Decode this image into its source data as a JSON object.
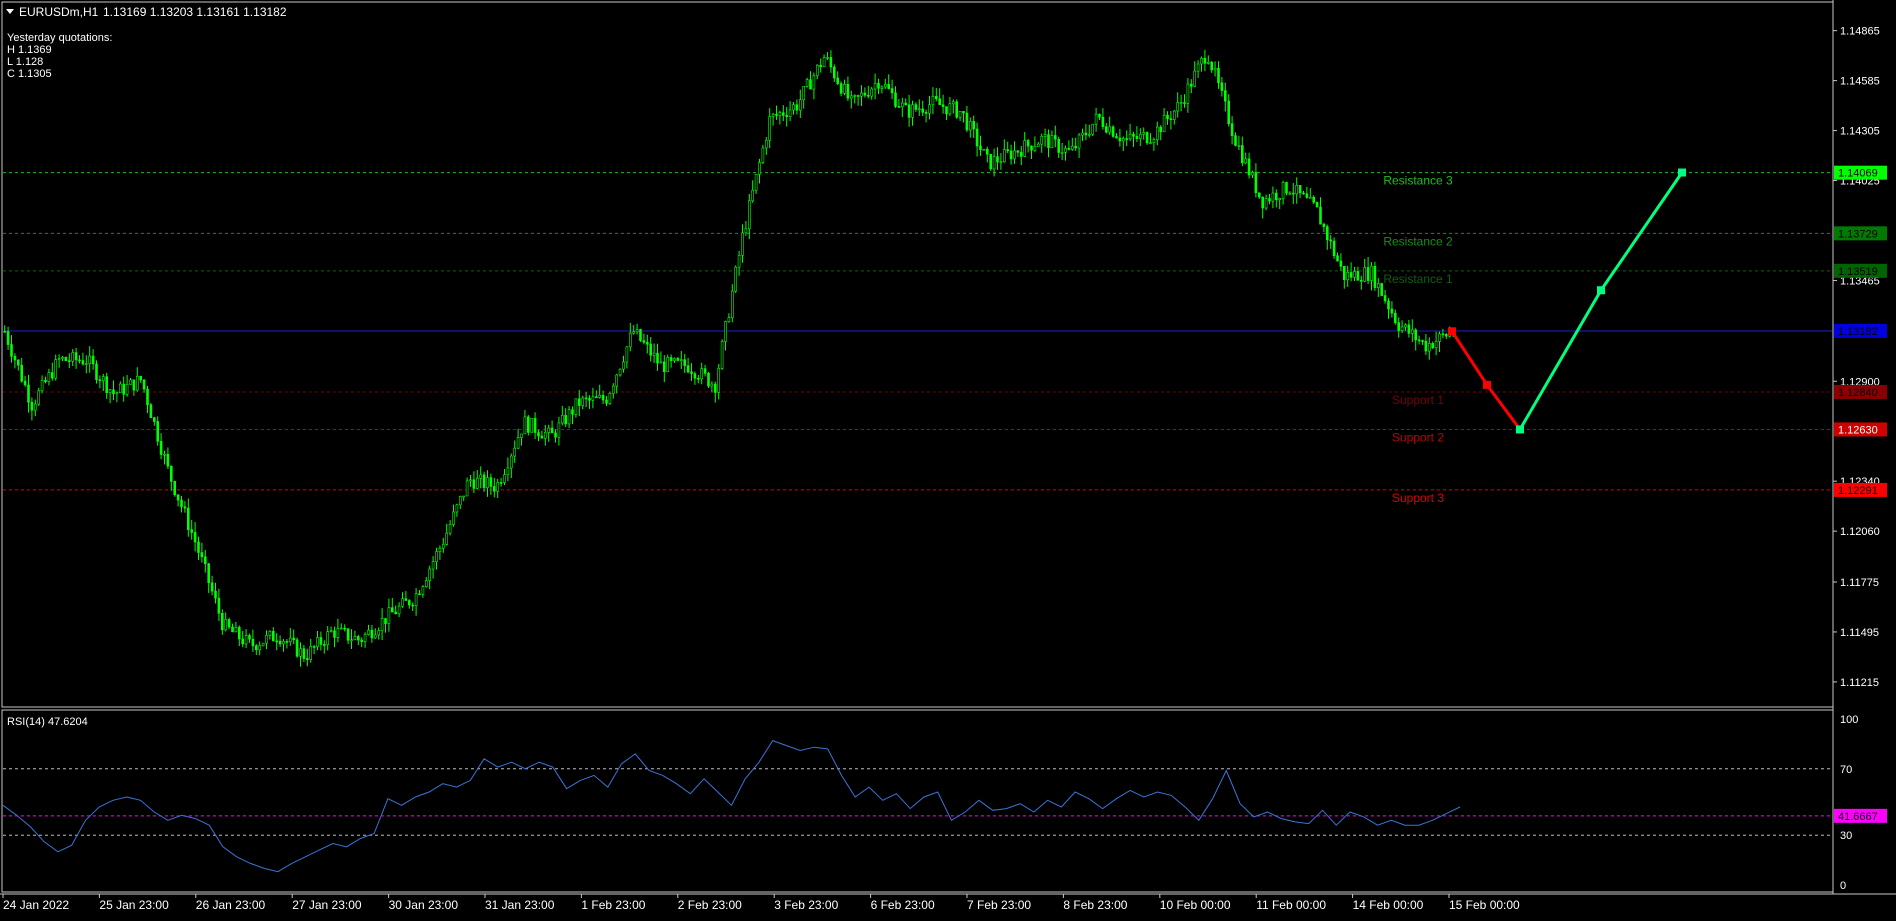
{
  "header": {
    "symbol": "EURUSDm,H1",
    "ohlc": "1.13169 1.13203 1.13161 1.13182",
    "yesterday_title": "Yesterday quotations:",
    "yesterday_high": "H 1.1369",
    "yesterday_low": "L 1.128",
    "yesterday_close": "C 1.1305"
  },
  "colors": {
    "background": "#000000",
    "bull_candle": "#00ff00",
    "bear_candle": "#00ff00",
    "pivot_line": "#0000ff",
    "resistance": "#00ff00",
    "support": "#ff0000",
    "rsi_line": "#3a75d8",
    "rsi_level_marker": "#ff00ff",
    "forecast_down": "#ff0000",
    "forecast_up": "#00ff7f",
    "axis_text": "#ffffff",
    "frame": "#c8c8c8"
  },
  "price_axis": {
    "ticks": [
      "1.14865",
      "1.14585",
      "1.14305",
      "1.14025",
      "1.13465",
      "1.12900",
      "1.12340",
      "1.12060",
      "1.11775",
      "1.11495",
      "1.11215"
    ],
    "tags": [
      {
        "label": "1.14069",
        "bg": "#00ff00",
        "fg": "#000000"
      },
      {
        "label": "1.13729",
        "bg": "#007a00",
        "fg": "#000000"
      },
      {
        "label": "1.13519",
        "bg": "#006400",
        "fg": "#000000"
      },
      {
        "label": "1.13182",
        "bg": "#0000e0",
        "fg": "#000000"
      },
      {
        "label": "1.12840",
        "bg": "#8a0000",
        "fg": "#000000"
      },
      {
        "label": "1.12630",
        "bg": "#d00000",
        "fg": "#ffffff"
      },
      {
        "label": "1.12291",
        "bg": "#ff0000",
        "fg": "#000000"
      }
    ]
  },
  "time_axis": {
    "labels": [
      "24 Jan 2022",
      "25 Jan 23:00",
      "26 Jan 23:00",
      "27 Jan 23:00",
      "30 Jan 23:00",
      "31 Jan 23:00",
      "1 Feb 23:00",
      "2 Feb 23:00",
      "3 Feb 23:00",
      "6 Feb 23:00",
      "7 Feb 23:00",
      "8 Feb 23:00",
      "10 Feb 00:00",
      "11 Feb 00:00",
      "14 Feb 00:00",
      "15 Feb 00:00"
    ]
  },
  "levels": [
    {
      "label": "Resistance 3",
      "value": 1.14069,
      "color": "#1fbf1f"
    },
    {
      "label": "Resistance 2",
      "value": 1.13729,
      "color": "#168f16"
    },
    {
      "label": "Resistance 1",
      "value": 1.13519,
      "color": "#0f5f0f"
    },
    {
      "label": "",
      "value": 1.13182,
      "color": "#1f1fd0"
    },
    {
      "label": "Support 1",
      "value": 1.1284,
      "color": "#7a0000"
    },
    {
      "label": "Support 2",
      "value": 1.1263,
      "color": "#c00000"
    },
    {
      "label": "Support 3",
      "value": 1.12291,
      "color": "#e00000"
    }
  ],
  "rsi": {
    "label": "RSI(14) 47.6204",
    "axis_ticks": [
      "100",
      "70",
      "30",
      "0"
    ],
    "level_marker": "41.6667"
  },
  "chart_data": [
    {
      "type": "candlestick",
      "title": "EURUSDm,H1",
      "ylim": [
        1.1108,
        1.1502
      ],
      "x_labels": [
        "24 Jan 2022",
        "25 Jan 23:00",
        "26 Jan 23:00",
        "27 Jan 23:00",
        "30 Jan 23:00",
        "31 Jan 23:00",
        "1 Feb 23:00",
        "2 Feb 23:00",
        "3 Feb 23:00",
        "6 Feb 23:00",
        "7 Feb 23:00",
        "8 Feb 23:00",
        "10 Feb 00:00",
        "11 Feb 00:00",
        "14 Feb 00:00",
        "15 Feb 00:00"
      ],
      "close_path": [
        {
          "t": "24 Jan 2022",
          "price": 1.1318
        },
        {
          "t": "25 Jan",
          "price": 1.1277
        },
        {
          "t": "25 Jan",
          "price": 1.1302
        },
        {
          "t": "25 Jan 23:00",
          "price": 1.1302
        },
        {
          "t": "26 Jan",
          "price": 1.1283
        },
        {
          "t": "26 Jan",
          "price": 1.1291
        },
        {
          "t": "26 Jan",
          "price": 1.1239
        },
        {
          "t": "26 Jan 23:00",
          "price": 1.1199
        },
        {
          "t": "27 Jan",
          "price": 1.1153
        },
        {
          "t": "27 Jan",
          "price": 1.1142
        },
        {
          "t": "27 Jan",
          "price": 1.1148
        },
        {
          "t": "27 Jan 23:00",
          "price": 1.1136
        },
        {
          "t": "28 Jan",
          "price": 1.115
        },
        {
          "t": "28 Jan",
          "price": 1.1145
        },
        {
          "t": "30 Jan 23:00",
          "price": 1.1158
        },
        {
          "t": "31 Jan",
          "price": 1.1169
        },
        {
          "t": "31 Jan",
          "price": 1.1199
        },
        {
          "t": "31 Jan",
          "price": 1.1235
        },
        {
          "t": "31 Jan 23:00",
          "price": 1.1231
        },
        {
          "t": "1 Feb",
          "price": 1.1267
        },
        {
          "t": "1 Feb",
          "price": 1.1259
        },
        {
          "t": "1 Feb",
          "price": 1.1278
        },
        {
          "t": "1 Feb 23:00",
          "price": 1.128
        },
        {
          "t": "2 Feb",
          "price": 1.1318
        },
        {
          "t": "2 Feb",
          "price": 1.1299
        },
        {
          "t": "2 Feb",
          "price": 1.1299
        },
        {
          "t": "2 Feb 23:00",
          "price": 1.1288
        },
        {
          "t": "3 Feb",
          "price": 1.1371
        },
        {
          "t": "3 Feb",
          "price": 1.1437
        },
        {
          "t": "3 Feb",
          "price": 1.1445
        },
        {
          "t": "3 Feb 23:00",
          "price": 1.1472
        },
        {
          "t": "4 Feb",
          "price": 1.1445
        },
        {
          "t": "4 Feb",
          "price": 1.1459
        },
        {
          "t": "6 Feb 23:00",
          "price": 1.1441
        },
        {
          "t": "7 Feb",
          "price": 1.1446
        },
        {
          "t": "7 Feb",
          "price": 1.1441
        },
        {
          "t": "7 Feb 23:00",
          "price": 1.1412
        },
        {
          "t": "8 Feb",
          "price": 1.1419
        },
        {
          "t": "8 Feb",
          "price": 1.1426
        },
        {
          "t": "8 Feb 23:00",
          "price": 1.1418
        },
        {
          "t": "9 Feb",
          "price": 1.1438
        },
        {
          "t": "9 Feb",
          "price": 1.1425
        },
        {
          "t": "9 Feb",
          "price": 1.1428
        },
        {
          "t": "10 Feb 00:00",
          "price": 1.1445
        },
        {
          "t": "10 Feb",
          "price": 1.1475
        },
        {
          "t": "10 Feb",
          "price": 1.1427
        },
        {
          "t": "11 Feb 00:00",
          "price": 1.1391
        },
        {
          "t": "11 Feb",
          "price": 1.1399
        },
        {
          "t": "11 Feb",
          "price": 1.1386
        },
        {
          "t": "11 Feb",
          "price": 1.1349
        },
        {
          "t": "14 Feb 00:00",
          "price": 1.1351
        },
        {
          "t": "14 Feb",
          "price": 1.1322
        },
        {
          "t": "14 Feb",
          "price": 1.131
        },
        {
          "t": "15 Feb 00:00",
          "price": 1.1318
        }
      ],
      "forecast_path": [
        {
          "step": 0,
          "price": 1.1318
        },
        {
          "step": 1,
          "price": 1.1288
        },
        {
          "step": 2,
          "price": 1.1263
        },
        {
          "step": 3,
          "price": 1.1341
        },
        {
          "step": 4,
          "price": 1.1407
        }
      ],
      "horizontal_levels": [
        1.14069,
        1.13729,
        1.13519,
        1.13182,
        1.1284,
        1.1263,
        1.12291
      ]
    },
    {
      "type": "line",
      "title": "RSI(14) 47.6204",
      "ylim": [
        0,
        100
      ],
      "levels": [
        70,
        30,
        41.6667
      ],
      "values": [
        48,
        42,
        35,
        26,
        20,
        24,
        39,
        47,
        51,
        53,
        51,
        44,
        39,
        42,
        40,
        36,
        23,
        17,
        13,
        10,
        8,
        13,
        17,
        21,
        25,
        23,
        28,
        31,
        52,
        48,
        53,
        56,
        61,
        59,
        63,
        76,
        71,
        74,
        70,
        74,
        71,
        58,
        63,
        66,
        59,
        73,
        79,
        69,
        66,
        61,
        55,
        64,
        56,
        48,
        64,
        74,
        87,
        84,
        81,
        83,
        82,
        66,
        53,
        59,
        51,
        55,
        46,
        53,
        56,
        39,
        44,
        51,
        45,
        46,
        49,
        44,
        51,
        47,
        56,
        52,
        46,
        52,
        57,
        53,
        56,
        54,
        47,
        39,
        52,
        69,
        49,
        41,
        44,
        40,
        38,
        37,
        45,
        36,
        44,
        41,
        36,
        39,
        36,
        36,
        39,
        43,
        47
      ]
    }
  ]
}
